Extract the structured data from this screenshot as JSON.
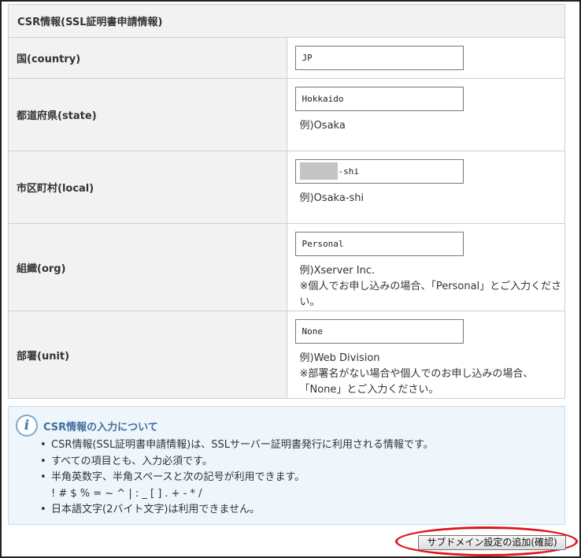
{
  "form": {
    "title": "CSR情報(SSL証明書申請情報)",
    "rows": [
      {
        "label": "国(country)",
        "value": "JP"
      },
      {
        "label": "都道府県(state)",
        "value": "Hokkaido",
        "hint": "例)Osaka"
      },
      {
        "label": "市区町村(local)",
        "value": "-shi",
        "hint": "例)Osaka-shi"
      },
      {
        "label": "組織(org)",
        "value": "Personal",
        "hint": "例)Xserver Inc.",
        "note": "※個人でお申し込みの場合、「Personal」とご入力ください。"
      },
      {
        "label": "部署(unit)",
        "value": "None",
        "hint": "例)Web Division",
        "note": "※部署名がない場合や個人でのお申し込みの場合、「None」とご入力ください。"
      }
    ]
  },
  "info": {
    "icon": "info-icon",
    "title": "CSR情報の入力について",
    "items": [
      "CSR情報(SSL証明書申請情報)は、SSLサーバー証明書発行に利用される情報です。",
      "すべての項目とも、入力必須です。",
      "半角英数字、半角スペースと次の記号が利用できます。",
      "日本語文字(2バイト文字)は利用できません。"
    ],
    "symbols": "! # $ % = ~ ^ | : _ [ ] . + - * /",
    "bullet": "•"
  },
  "actions": {
    "confirm_label": "サブドメイン設定の追加(確認)",
    "highlight_color": "#e0151b"
  }
}
